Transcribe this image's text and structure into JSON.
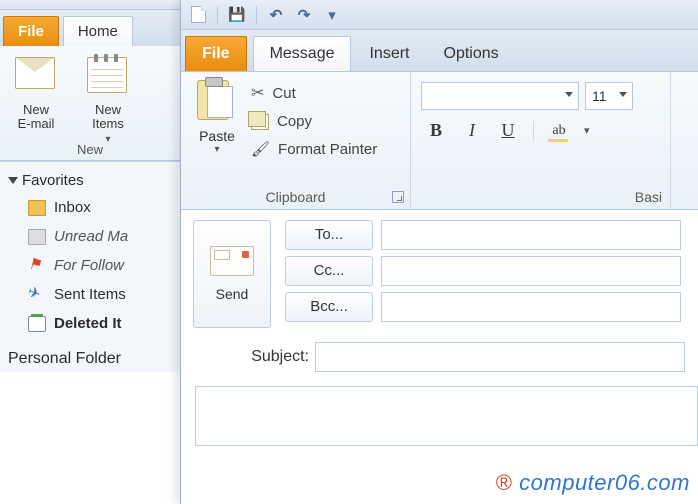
{
  "back": {
    "tabs": {
      "file": "File",
      "home": "Home"
    },
    "ribbon": {
      "new_email": "New\nE-mail",
      "new_items": "New\nItems",
      "group": "New"
    },
    "sidebar": {
      "favorites": "Favorites",
      "items": [
        {
          "label": "Inbox"
        },
        {
          "label": "Unread Ma"
        },
        {
          "label": "For Follow"
        },
        {
          "label": "Sent Items"
        },
        {
          "label": "Deleted It"
        }
      ],
      "personal": "Personal Folder"
    }
  },
  "front": {
    "tabs": {
      "file": "File",
      "message": "Message",
      "insert": "Insert",
      "options": "Options"
    },
    "clipboard": {
      "paste": "Paste",
      "cut": "Cut",
      "copy": "Copy",
      "format_painter": "Format Painter",
      "group": "Clipboard"
    },
    "font": {
      "size": "11",
      "group": "Basi",
      "highlight": "ab"
    },
    "compose": {
      "send": "Send",
      "to": "To...",
      "cc": "Cc...",
      "bcc": "Bcc...",
      "subject": "Subject:"
    }
  },
  "watermark": {
    "text": "computer06.com",
    "symbol": "®"
  }
}
